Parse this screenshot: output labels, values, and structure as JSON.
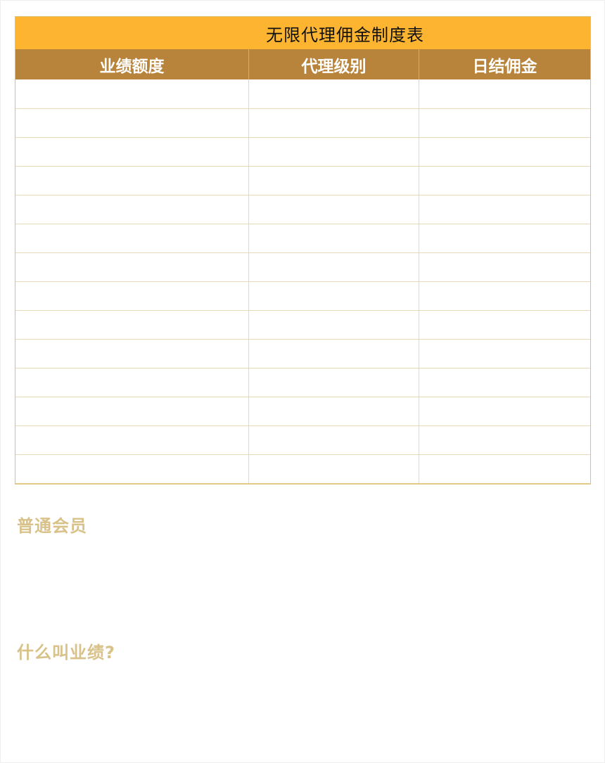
{
  "table": {
    "title": "无限代理佣金制度表",
    "columns": [
      "业绩额度",
      "代理级别",
      "日结佣金"
    ],
    "rows": [
      [
        "",
        "",
        ""
      ],
      [
        "",
        "",
        ""
      ],
      [
        "",
        "",
        ""
      ],
      [
        "",
        "",
        ""
      ],
      [
        "",
        "",
        ""
      ],
      [
        "",
        "",
        ""
      ],
      [
        "",
        "",
        ""
      ],
      [
        "",
        "",
        ""
      ],
      [
        "",
        "",
        ""
      ],
      [
        "",
        "",
        ""
      ],
      [
        "",
        "",
        ""
      ],
      [
        "",
        "",
        ""
      ],
      [
        "",
        "",
        ""
      ],
      [
        "",
        "",
        ""
      ]
    ]
  },
  "sections": {
    "regular_member_heading": "普通会员",
    "what_is_performance_heading": "什么叫业绩?"
  },
  "colors": {
    "title_bar": "#fdb531",
    "header_row": "#b8843b",
    "grid_line": "#e6d9b8",
    "section_heading": "#d8c28a"
  }
}
